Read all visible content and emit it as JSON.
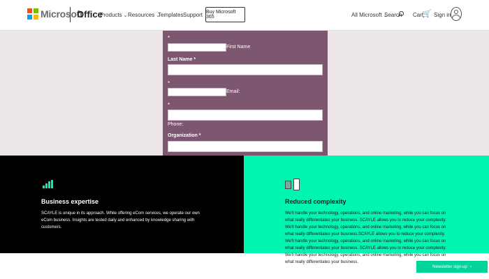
{
  "header": {
    "brand": "Microsoft",
    "product": "Office",
    "nav": [
      {
        "label": "Products",
        "chevron": "⌄"
      },
      {
        "label": "Resources",
        "chevron": "⌄"
      },
      {
        "label": "Templates",
        "chevron": ""
      },
      {
        "label": "Support",
        "chevron": ""
      }
    ],
    "buy_button": "Buy Microsoft 365",
    "all_microsoft": "All Microsoft",
    "all_microsoft_chevron": "⌄",
    "search": "Search",
    "cart": "Cart",
    "cart_icon": "🛒",
    "sign_in": "Sign in",
    "logo_colors": [
      "#f25022",
      "#7fba00",
      "#00a4ef",
      "#ffb900"
    ]
  },
  "form": {
    "required_mark": "*",
    "first_name_label": "First Name",
    "last_name_label": "Last Name *",
    "email_label": "Email:",
    "phone_label": "Phone:",
    "organization_label": "Organization *",
    "panel_color": "#7d5770"
  },
  "features": {
    "left": {
      "icon": "bar-chart-icon",
      "title": "Business expertise",
      "body": "SCAYLE is unique in its approach. While offering eCom services, we operate our own eCom business. Insights are tested daily and enhanced by knowledge sharing with customers."
    },
    "right": {
      "icon": "devices-icon",
      "title": "Reduced complexity",
      "body": "We'll handle your technology, operations, and online marketing, while you can focus on what really differentiates your business. SCAYLE allows you to reduce your complexity. We'll handle your technology, operations, and online marketing, while you can focus on what really differentiates your business.SCAYLE allows you to reduce your complexity. We'll handle your technology, operations, and online marketing, while you can focus on what really differentiates your business. SCAYLE allows you to reduce your complexity. We'll handle your technology, operations, and online marketing, while you can focus on what really differentiates your business."
    }
  },
  "newsletter": {
    "label": "Newsletter sign-up",
    "arrow": "›"
  },
  "colors": {
    "accent_green": "#00f5b1",
    "newsletter_green": "#00d49a",
    "form_background": "#ece6ea"
  }
}
